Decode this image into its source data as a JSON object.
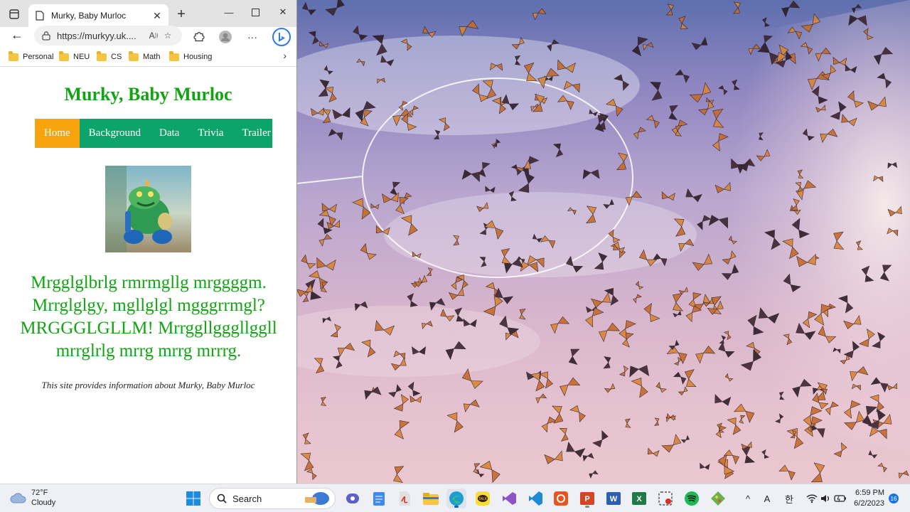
{
  "browser": {
    "tab_title": "Murky, Baby Murloc",
    "url": "https://murkyy.uk....",
    "bookmarks": [
      "Personal",
      "NEU",
      "CS",
      "Math",
      "Housing"
    ]
  },
  "page": {
    "title": "Murky, Baby Murloc",
    "nav": [
      "Home",
      "Background",
      "Data",
      "Trivia",
      "Trailer"
    ],
    "active_nav": "Home",
    "murloc_lines": [
      "Mrgglglbrlg rmrmgllg mrggggm.",
      "Mrrglglgy, mgllglgl mgggrrmgl?",
      "MRGGGLGLLM! Mrrggllgggllggll",
      "mrrglrlg mrrg mrrg mrrrg."
    ],
    "info": "This site provides information about Murky, Baby Murloc",
    "colors": {
      "title_green": "#13a413",
      "nav_bg": "#0ba56a",
      "nav_active": "#f7a30b"
    }
  },
  "taskbar": {
    "weather_temp": "72°F",
    "weather_desc": "Cloudy",
    "search_label": "Search",
    "ime_a": "A",
    "ime_han": "한",
    "time": "6:59 PM",
    "date": "6/2/2023",
    "notification_count": "16"
  }
}
